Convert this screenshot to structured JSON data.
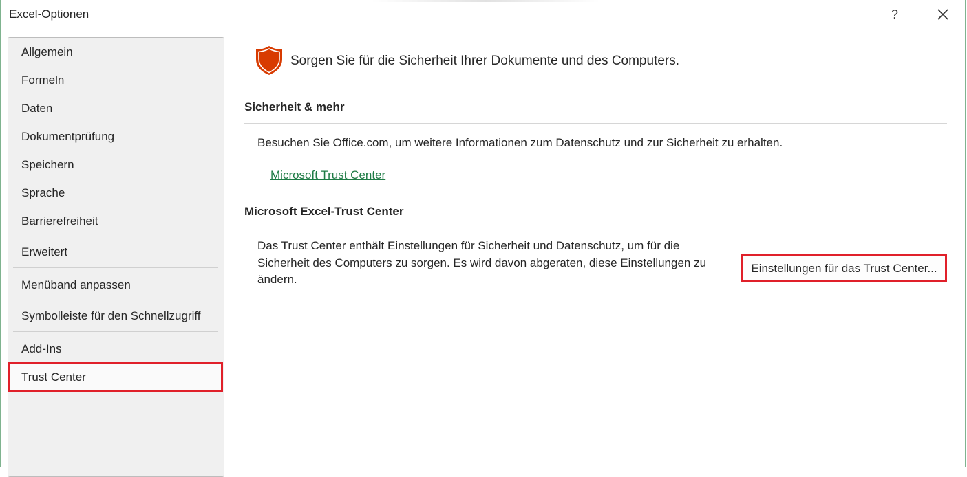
{
  "window": {
    "title": "Excel-Optionen",
    "help_label": "?"
  },
  "sidebar": {
    "items": [
      {
        "label": "Allgemein"
      },
      {
        "label": "Formeln"
      },
      {
        "label": "Daten"
      },
      {
        "label": "Dokumentprüfung"
      },
      {
        "label": "Speichern"
      },
      {
        "label": "Sprache"
      },
      {
        "label": "Barrierefreiheit"
      },
      {
        "label": "Erweitert"
      },
      {
        "label": "Menüband anpassen"
      },
      {
        "label": "Symbolleiste für den Schnellzugriff"
      },
      {
        "label": "Add-Ins"
      },
      {
        "label": "Trust Center",
        "selected": true
      }
    ]
  },
  "main": {
    "heading": "Sorgen Sie für die Sicherheit Ihrer Dokumente und des Computers.",
    "security_section": {
      "title": "Sicherheit & mehr",
      "description": "Besuchen Sie Office.com, um weitere Informationen zum Datenschutz und zur Sicherheit zu erhalten.",
      "link_label": "Microsoft Trust Center"
    },
    "trust_center_section": {
      "title": "Microsoft Excel-Trust Center",
      "line1": "Das Trust Center enthält Einstellungen für Sicherheit und Datenschutz, um für die",
      "line2": "Sicherheit des Computers zu sorgen. Es wird davon abgeraten, diese Einstellungen zu",
      "line3": "ändern.",
      "button_label": "Einstellungen für das Trust Center..."
    }
  },
  "colors": {
    "accent_link": "#1e7b45",
    "highlight_border": "#e0202a",
    "shield": "#d83b01",
    "window_border": "#7fb38f"
  },
  "icons": {
    "shield": "shield-icon",
    "close": "close-icon"
  }
}
